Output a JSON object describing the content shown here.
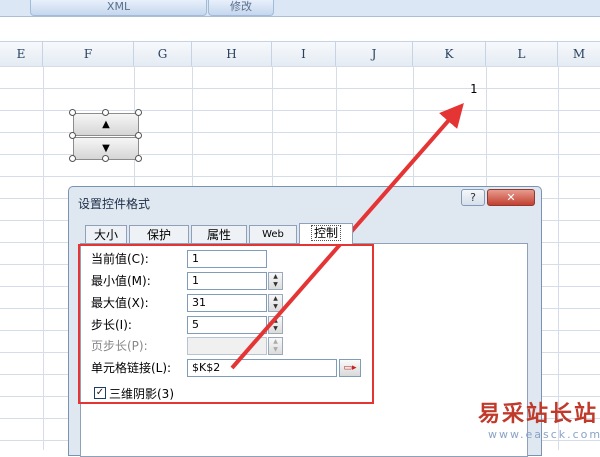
{
  "ribbon": {
    "tabs": [
      "XML",
      "修改"
    ]
  },
  "sheet": {
    "columns": [
      "E",
      "F",
      "G",
      "H",
      "I",
      "J",
      "K",
      "L",
      "M"
    ],
    "cell_k2_value": "1"
  },
  "spin_control": {
    "up_glyph": "▲",
    "down_glyph": "▼"
  },
  "dialog": {
    "title": "设置控件格式",
    "help_label": "?",
    "close_label": "✕",
    "tabs": [
      {
        "label": "大小",
        "active": false
      },
      {
        "label": "保护",
        "active": false
      },
      {
        "label": "属性",
        "active": false
      },
      {
        "label": "Web",
        "active": false
      },
      {
        "label": "控制",
        "active": true
      }
    ],
    "fields": {
      "current_value": {
        "label": "当前值(C):",
        "value": "1"
      },
      "min_value": {
        "label": "最小值(M):",
        "value": "1"
      },
      "max_value": {
        "label": "最大值(X):",
        "value": "31"
      },
      "step": {
        "label": "步长(I):",
        "value": "5"
      },
      "page_step": {
        "label": "页步长(P):",
        "value": ""
      },
      "cell_link": {
        "label": "单元格链接(L):",
        "value": "$K$2"
      }
    },
    "shading_3d": {
      "label": "三维阴影(3)",
      "checked": true
    }
  },
  "watermark": {
    "text": "易采站长站",
    "url": "www.easck.com"
  },
  "colors": {
    "highlight": "#e53434",
    "arrow": "#e53434",
    "watermark": "#c03a2b"
  }
}
